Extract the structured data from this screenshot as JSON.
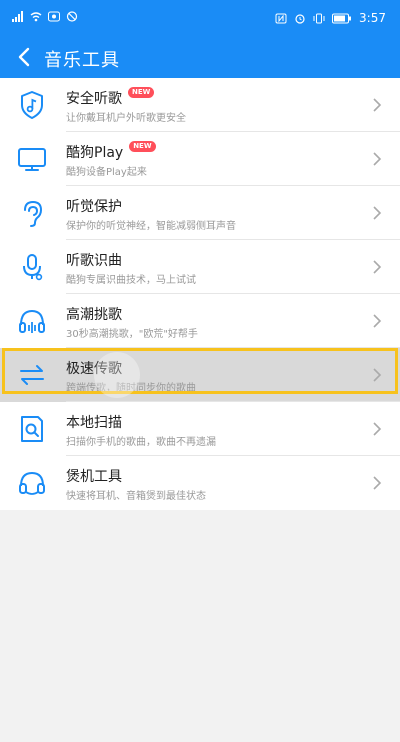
{
  "status_bar": {
    "time": "3:57"
  },
  "header": {
    "title": "音乐工具"
  },
  "items": [
    {
      "title": "安全听歌",
      "badge": "NEW",
      "subtitle": "让你戴耳机户外听歌更安全",
      "icon": "shield-music-icon"
    },
    {
      "title": "酷狗Play",
      "badge": "NEW",
      "subtitle": "酷狗设备Play起来",
      "icon": "monitor-icon"
    },
    {
      "title": "听觉保护",
      "badge": "",
      "subtitle": "保护你的听觉神经，智能减弱侧耳声音",
      "icon": "ear-icon"
    },
    {
      "title": "听歌识曲",
      "badge": "",
      "subtitle": "酷狗专属识曲技术，马上试试",
      "icon": "microphone-icon"
    },
    {
      "title": "高潮挑歌",
      "badge": "",
      "subtitle": "30秒高潮挑歌，\"欧荒\"好帮手",
      "icon": "headphones-icon"
    },
    {
      "title": "极速传歌",
      "badge": "",
      "subtitle": "跨端传歌，随时同步你的歌曲",
      "icon": "transfer-arrows-icon"
    },
    {
      "title": "本地扫描",
      "badge": "",
      "subtitle": "扫描你手机的歌曲，歌曲不再遗漏",
      "icon": "scan-icon"
    },
    {
      "title": "煲机工具",
      "badge": "",
      "subtitle": "快速将耳机、音箱煲到最佳状态",
      "icon": "headset-icon"
    }
  ],
  "colors": {
    "primary": "#1a8cf6",
    "highlight_border": "#f7c21d",
    "badge": "#ff4f5a"
  }
}
